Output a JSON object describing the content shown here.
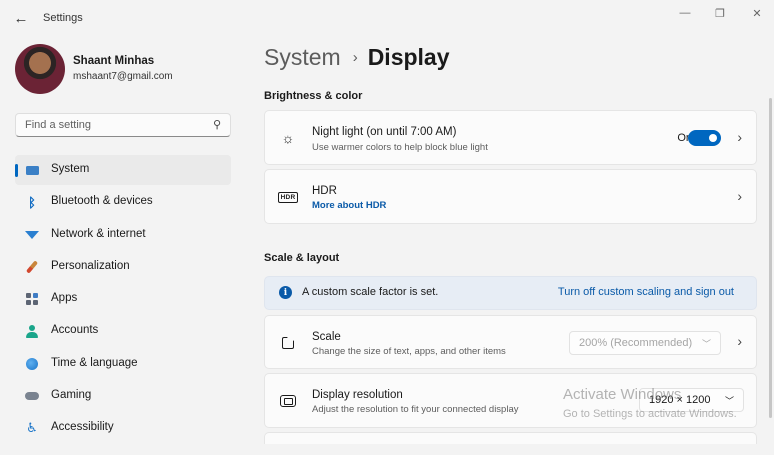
{
  "window": {
    "title": "Settings",
    "back_glyph": "←",
    "min_glyph": "—",
    "max_glyph": "❐",
    "close_glyph": "✕"
  },
  "profile": {
    "name": "Shaant Minhas",
    "email": "mshaant7@gmail.com"
  },
  "search": {
    "placeholder": "Find a setting",
    "icon": "search-icon"
  },
  "sidebar": {
    "items": [
      {
        "label": "System",
        "icon": "system-icon",
        "active": true
      },
      {
        "label": "Bluetooth & devices",
        "icon": "bluetooth-icon"
      },
      {
        "label": "Network & internet",
        "icon": "wifi-icon"
      },
      {
        "label": "Personalization",
        "icon": "brush-icon"
      },
      {
        "label": "Apps",
        "icon": "apps-icon"
      },
      {
        "label": "Accounts",
        "icon": "accounts-icon"
      },
      {
        "label": "Time & language",
        "icon": "globe-icon"
      },
      {
        "label": "Gaming",
        "icon": "gamepad-icon"
      },
      {
        "label": "Accessibility",
        "icon": "accessibility-icon"
      }
    ]
  },
  "breadcrumb": {
    "parent": "System",
    "separator": "›",
    "current": "Display"
  },
  "brightness_section": {
    "title": "Brightness & color",
    "night_light": {
      "title": "Night light (on until 7:00 AM)",
      "subtitle": "Use warmer colors to help block blue light",
      "toggle_label": "On",
      "toggle_on": true
    },
    "hdr": {
      "title": "HDR",
      "link": "More about HDR",
      "icon_text": "HDR"
    }
  },
  "scale_section": {
    "title": "Scale & layout",
    "info": {
      "text": "A custom scale factor is set.",
      "link": "Turn off custom scaling and sign out",
      "icon_glyph": "i"
    },
    "scale": {
      "title": "Scale",
      "subtitle": "Change the size of text, apps, and other items",
      "value": "200% (Recommended)",
      "disabled": true
    },
    "resolution": {
      "title": "Display resolution",
      "subtitle": "Adjust the resolution to fit your connected display",
      "value": "1920 × 1200"
    }
  },
  "watermark": {
    "title": "Activate Windows",
    "subtitle": "Go to Settings to activate Windows."
  },
  "colors": {
    "accent": "#0067c0",
    "link": "#0a5aa8",
    "background": "#f3f3f3",
    "card": "#fbfbfb",
    "info_bg": "#e7edf5"
  }
}
